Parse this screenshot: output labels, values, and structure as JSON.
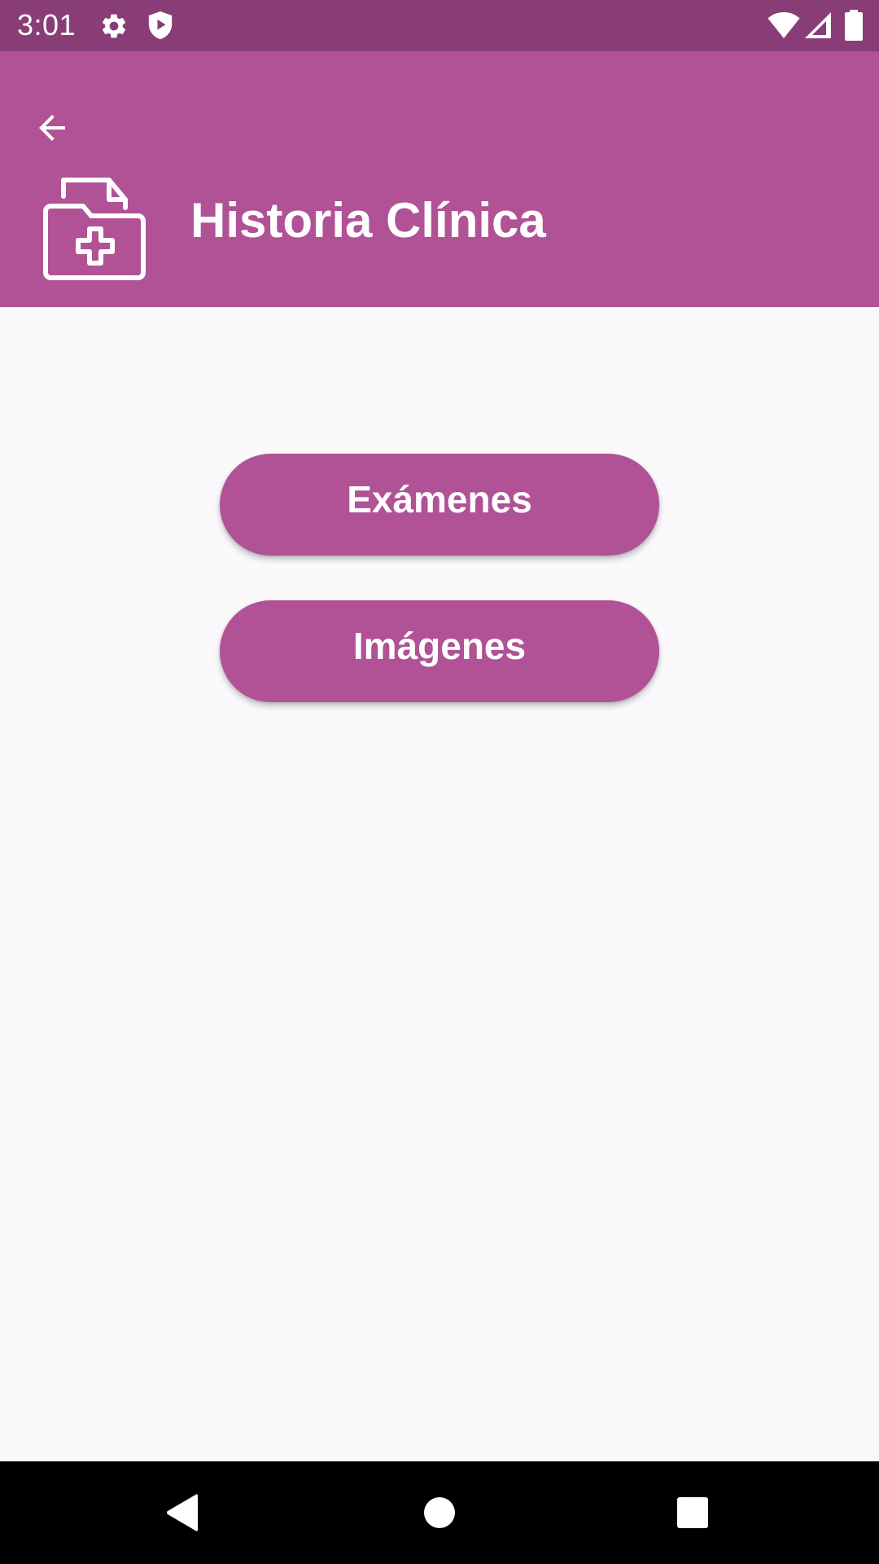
{
  "status_bar": {
    "time": "3:01",
    "background": "#883d76",
    "left_icons": [
      "settings-gear-icon",
      "shield-play-icon"
    ],
    "right_icons": [
      "wifi-icon",
      "cell-signal-icon",
      "battery-icon"
    ]
  },
  "app_bar": {
    "title": "Historia Clínica",
    "back_icon": "arrow-left-icon",
    "header_icon": "medical-folder-icon",
    "background": "#b05295"
  },
  "main": {
    "buttons": [
      {
        "label": "Exámenes"
      },
      {
        "label": "Imágenes"
      }
    ],
    "button_color": "#b05295",
    "background": "#fbf9fb"
  },
  "nav_bar": {
    "buttons": [
      "back-triangle-icon",
      "home-circle-icon",
      "recents-square-icon"
    ],
    "background": "#000000"
  }
}
